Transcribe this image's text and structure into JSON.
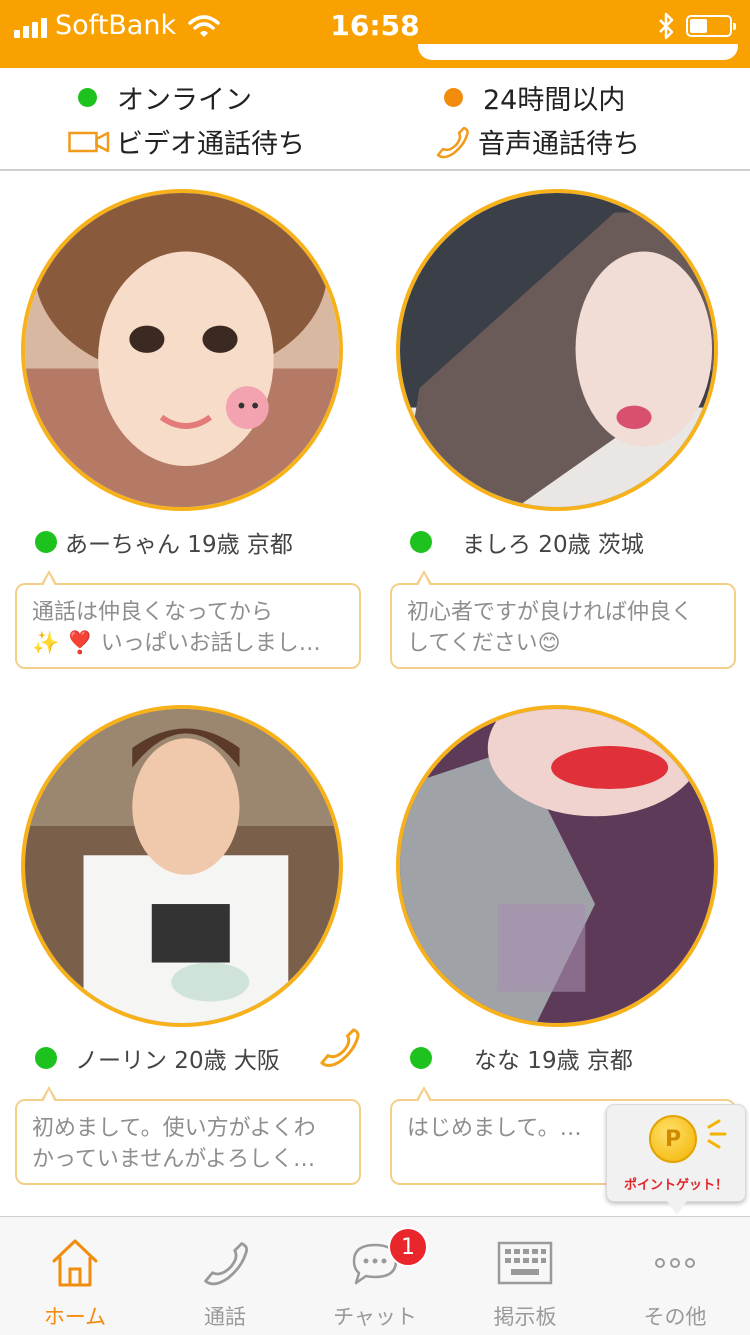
{
  "status_bar": {
    "carrier": "SoftBank",
    "time": "16:58",
    "battery_level": 0.45
  },
  "legend": {
    "online": "オンライン",
    "within24h": "24時間以内",
    "video_wait": "ビデオ通話待ち",
    "voice_wait": "音声通話待ち"
  },
  "profiles": [
    {
      "name": "あーちゃん 19歳 京都",
      "message_line1": "通話は仲良くなってから",
      "message_line2": "✨ ❣️ いっぱいお話しまし…"
    },
    {
      "name": "ましろ 20歳 茨城",
      "message_line1": "初心者ですが良ければ仲良く",
      "message_line2": "してください😊"
    },
    {
      "name": "ノーリン 20歳 大阪",
      "message_line1": "初めまして。使い方がよくわ",
      "message_line2": "かっていませんがよろしく…"
    },
    {
      "name": "なな 19歳 京都",
      "message_line1": "はじめまして。…",
      "message_line2": ""
    }
  ],
  "point_get": {
    "coin_letter": "P",
    "label": "ポイントゲット！"
  },
  "tabs": [
    {
      "label": "ホーム",
      "icon": "home-icon"
    },
    {
      "label": "通話",
      "icon": "phone-icon"
    },
    {
      "label": "チャット",
      "icon": "chat-icon",
      "badge": "1"
    },
    {
      "label": "掲示板",
      "icon": "keyboard-icon"
    },
    {
      "label": "その他",
      "icon": "more-icon"
    }
  ],
  "colors": {
    "accent": "#f9a100",
    "online": "#1ec21e",
    "recent": "#f28c0c",
    "frame": "#f7b21b"
  }
}
